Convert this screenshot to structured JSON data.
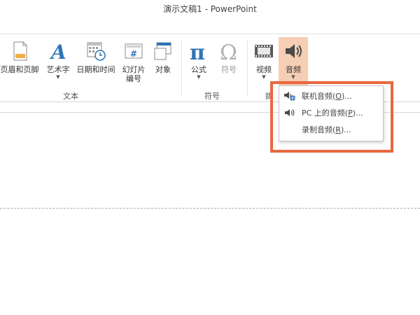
{
  "window": {
    "title": "演示文稿1 - PowerPoint"
  },
  "ribbon": {
    "buttons": {
      "header_footer": "页眉和页脚",
      "wordart": "艺术字",
      "datetime": "日期和时间",
      "slide_number_1": "幻灯片",
      "slide_number_2": "编号",
      "object": "对象",
      "equation": "公式",
      "symbol": "符号",
      "video": "视频",
      "audio": "音频"
    },
    "groups": {
      "text": "文本",
      "symbols": "符号",
      "media_partial": "媒"
    }
  },
  "audio_menu": {
    "items": [
      {
        "label": "联机音频(",
        "hotkey": "O",
        "suffix": ")..."
      },
      {
        "label": "PC 上的音频(",
        "hotkey": "P",
        "suffix": ")..."
      },
      {
        "label": "录制音频(",
        "hotkey": "R",
        "suffix": ")..."
      }
    ]
  },
  "colors": {
    "accent_orange": "#e8683f",
    "active_button": "#f5ceb3",
    "equation_blue": "#2e75b6"
  },
  "icons": {
    "header_footer": "document-header-icon",
    "wordart": "wordart-a-icon",
    "datetime": "calendar-clock-icon",
    "slide_number": "hash-box-icon",
    "object": "object-window-icon",
    "equation": "pi-icon",
    "symbol": "omega-icon",
    "video": "film-strip-icon",
    "audio": "speaker-icon"
  }
}
